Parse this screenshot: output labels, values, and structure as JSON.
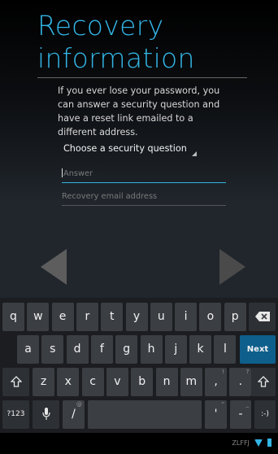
{
  "page": {
    "title_line1": "Recovery",
    "title_line2": "information",
    "description": "If you ever lose your password, you can answer a security question and have a reset link emailed to a different address.",
    "security_question_label": "Choose a security question",
    "answer_placeholder": "Answer",
    "email_placeholder": "Recovery email address"
  },
  "colors": {
    "accent": "#33b5e5",
    "next_key": "#0e5f8c"
  },
  "keyboard": {
    "row1": [
      {
        "label": "q",
        "hint": ""
      },
      {
        "label": "w",
        "hint": ""
      },
      {
        "label": "e",
        "hint": ""
      },
      {
        "label": "r",
        "hint": ""
      },
      {
        "label": "t",
        "hint": ""
      },
      {
        "label": "y",
        "hint": ""
      },
      {
        "label": "u",
        "hint": ""
      },
      {
        "label": "i",
        "hint": ""
      },
      {
        "label": "o",
        "hint": ""
      },
      {
        "label": "p",
        "hint": ""
      }
    ],
    "row2": [
      {
        "label": "a"
      },
      {
        "label": "s"
      },
      {
        "label": "d"
      },
      {
        "label": "f"
      },
      {
        "label": "g"
      },
      {
        "label": "h"
      },
      {
        "label": "j"
      },
      {
        "label": "k"
      },
      {
        "label": "l"
      }
    ],
    "row3": [
      {
        "label": "z"
      },
      {
        "label": "x"
      },
      {
        "label": "c"
      },
      {
        "label": "v"
      },
      {
        "label": "b"
      },
      {
        "label": "n"
      },
      {
        "label": "m"
      },
      {
        "label": ",",
        "hint": "!"
      },
      {
        "label": ".",
        "hint": "?"
      }
    ],
    "next_label": "Next",
    "symbols_label": "?123",
    "slash_label": "/",
    "slash_hint": "@",
    "apostrophe_label": "'",
    "apostrophe_hint": "\"",
    "dash_label": "-",
    "dash_hint": "_",
    "smiley_label": ":-)",
    "icons": [
      "backspace-icon",
      "shift-icon",
      "microphone-icon"
    ]
  },
  "status": {
    "text": "ZLFFJ",
    "icons": [
      "wifi-icon",
      "battery-icon"
    ]
  }
}
